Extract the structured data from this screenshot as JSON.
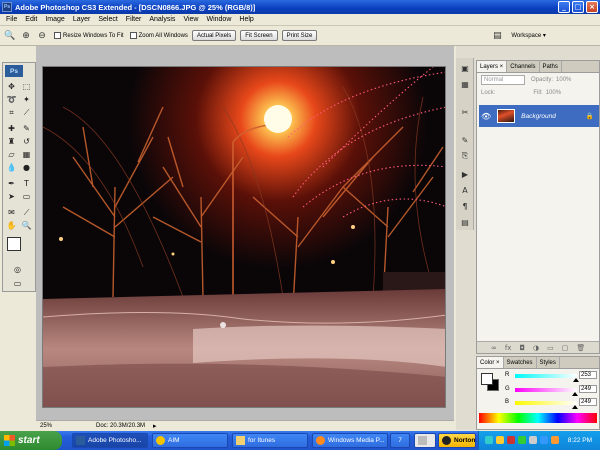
{
  "window": {
    "title": "Adobe Photoshop CS3 Extended - [DSCN0866.JPG @ 25% (RGB/8)]",
    "app_icon": "Ps"
  },
  "menu": [
    "File",
    "Edit",
    "Image",
    "Layer",
    "Select",
    "Filter",
    "Analysis",
    "View",
    "Window",
    "Help"
  ],
  "options_bar": {
    "resize_windows_label": "Resize Windows To Fit",
    "zoom_all_label": "Zoom All Windows",
    "actual_pixels": "Actual Pixels",
    "fit_screen": "Fit Screen",
    "print_size": "Print Size",
    "workspace": "Workspace ▾"
  },
  "toolbox": {
    "logo": "Ps"
  },
  "status": {
    "zoom": "25%",
    "doc": "Doc: 20.3M/20.3M"
  },
  "layers_panel": {
    "tabs": [
      "Layers ×",
      "Channels",
      "Paths"
    ],
    "blend_mode": "Normal",
    "opacity_label": "Opacity:",
    "opacity_value": "100%",
    "lock_label": "Lock:",
    "fill_label": "Fill:",
    "fill_value": "100%",
    "layer_name": "Background"
  },
  "color_panel": {
    "tabs": [
      "Color ×",
      "Swatches",
      "Styles"
    ],
    "r_label": "R",
    "g_label": "G",
    "b_label": "B",
    "r_value": "253",
    "g_value": "249",
    "b_value": "249"
  },
  "taskbar": {
    "start": "start",
    "items": [
      "Adobe Photosho...",
      "AIM",
      "for Itunes",
      "Windows Media P..."
    ],
    "badge": "7",
    "norton": "Norton",
    "clock": "8:22 PM"
  },
  "colors": {
    "accent": "#0a3fbf",
    "layer_selected": "#3d6cc0",
    "taskbar": "#245edb",
    "start": "#2e8a2f"
  }
}
